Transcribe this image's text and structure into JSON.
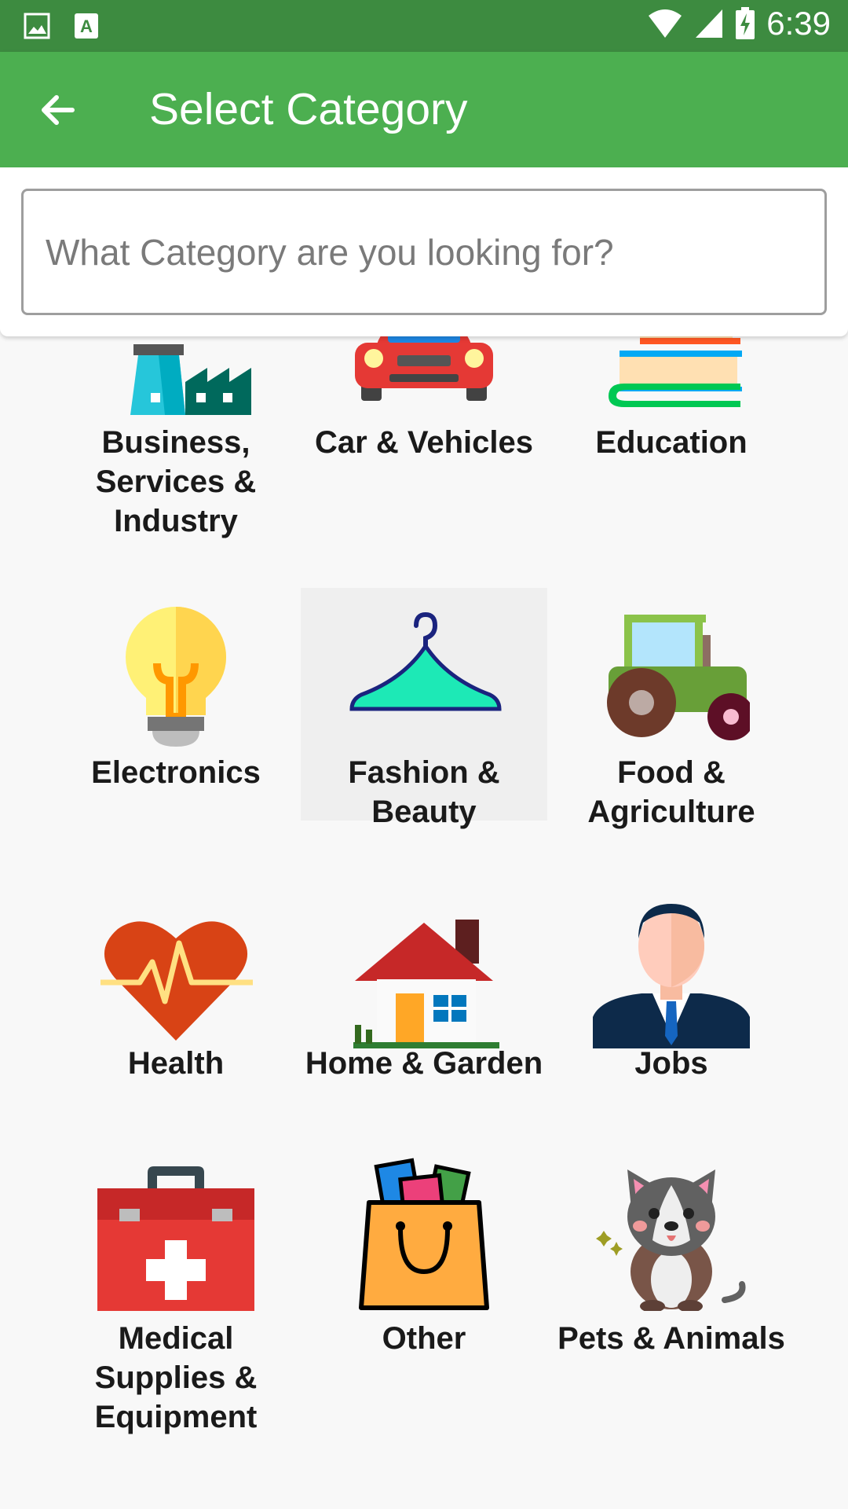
{
  "status_bar": {
    "time": "6:39",
    "icons": [
      "image-icon",
      "app-a-icon",
      "wifi-icon",
      "signal-icon",
      "battery-charging-icon"
    ]
  },
  "app_bar": {
    "title": "Select Category",
    "back_icon": "arrow-back-icon"
  },
  "search": {
    "placeholder": "What Category are you looking for?",
    "value": ""
  },
  "categories": [
    {
      "label": "Business, Services & Industry",
      "icon": "factory-icon"
    },
    {
      "label": "Car & Vehicles",
      "icon": "car-icon"
    },
    {
      "label": "Education",
      "icon": "books-icon"
    },
    {
      "label": "Electronics",
      "icon": "lightbulb-icon"
    },
    {
      "label": "Fashion & Beauty",
      "icon": "hanger-icon",
      "selected": true
    },
    {
      "label": "Food & Agriculture",
      "icon": "tractor-icon"
    },
    {
      "label": "Health",
      "icon": "heart-pulse-icon"
    },
    {
      "label": "Home & Garden",
      "icon": "house-icon"
    },
    {
      "label": "Jobs",
      "icon": "businessman-icon"
    },
    {
      "label": "Medical Supplies & Equipment",
      "icon": "first-aid-kit-icon"
    },
    {
      "label": "Other",
      "icon": "shopping-bag-icon"
    },
    {
      "label": "Pets & Animals",
      "icon": "dog-icon"
    }
  ],
  "colors": {
    "status_bar": "#3d8b40",
    "app_bar": "#4caf50",
    "background": "#f8f8f8",
    "selected_tile": "#efefef"
  }
}
